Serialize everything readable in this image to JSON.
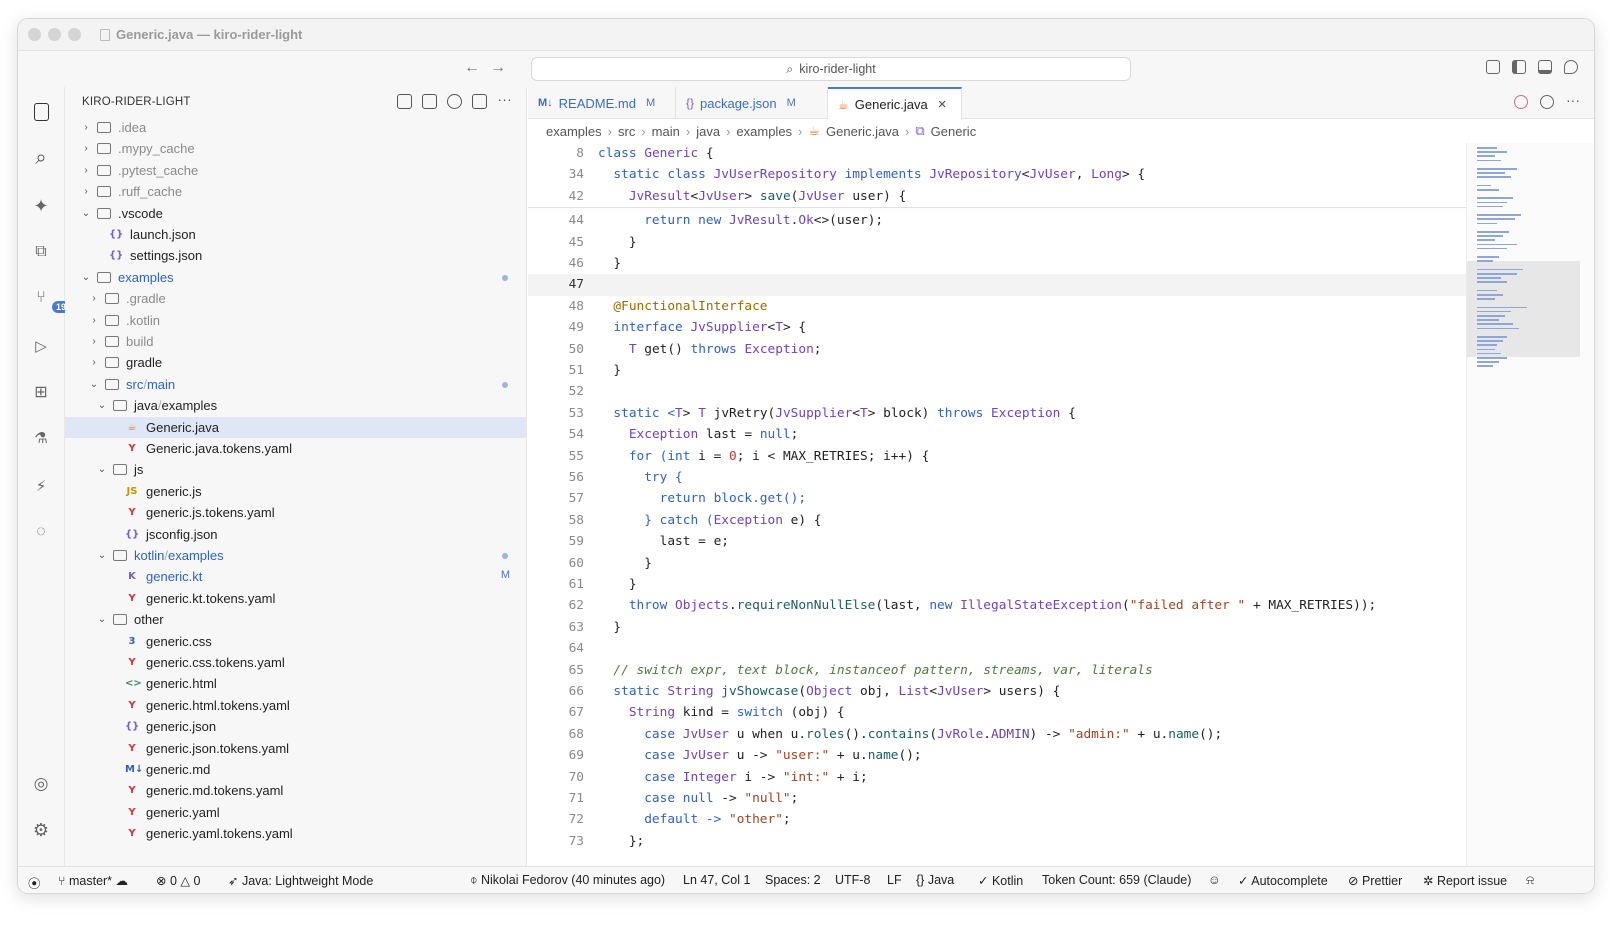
{
  "window": {
    "title": "Generic.java — kiro-rider-light"
  },
  "command_center": {
    "label": "kiro-rider-light"
  },
  "activity": {
    "source_control_badge": "19"
  },
  "explorer": {
    "title": "KIRO-RIDER-LIGHT",
    "items": [
      {
        "label": ".idea"
      },
      {
        "label": ".mypy_cache"
      },
      {
        "label": ".pytest_cache"
      },
      {
        "label": ".ruff_cache"
      },
      {
        "label": ".vscode"
      },
      {
        "label": "launch.json"
      },
      {
        "label": "settings.json"
      },
      {
        "label": "examples"
      },
      {
        "label": ".gradle"
      },
      {
        "label": ".kotlin"
      },
      {
        "label": "build"
      },
      {
        "label": "gradle"
      },
      {
        "label": "src",
        "label2": "main"
      },
      {
        "label": "java",
        "label2": "examples"
      },
      {
        "label": "Generic.java"
      },
      {
        "label": "Generic.java.tokens.yaml"
      },
      {
        "label": "js"
      },
      {
        "label": "generic.js"
      },
      {
        "label": "generic.js.tokens.yaml"
      },
      {
        "label": "jsconfig.json"
      },
      {
        "label": "kotlin",
        "label2": "examples"
      },
      {
        "label": "generic.kt",
        "badge": "M"
      },
      {
        "label": "generic.kt.tokens.yaml"
      },
      {
        "label": "other"
      },
      {
        "label": "generic.css"
      },
      {
        "label": "generic.css.tokens.yaml"
      },
      {
        "label": "generic.html"
      },
      {
        "label": "generic.html.tokens.yaml"
      },
      {
        "label": "generic.json"
      },
      {
        "label": "generic.json.tokens.yaml"
      },
      {
        "label": "generic.md"
      },
      {
        "label": "generic.md.tokens.yaml"
      },
      {
        "label": "generic.yaml"
      },
      {
        "label": "generic.yaml.tokens.yaml"
      }
    ]
  },
  "tabs": [
    {
      "label": "README.md",
      "badge": "M",
      "icon": "M↓"
    },
    {
      "label": "package.json",
      "badge": "M",
      "icon": "{}"
    },
    {
      "label": "Generic.java",
      "icon": "☕",
      "close": "×"
    }
  ],
  "breadcrumb": [
    "examples",
    "src",
    "main",
    "java",
    "examples",
    "Generic.java",
    "Generic"
  ],
  "statusbar": {
    "branch": "master*",
    "errors": "0",
    "warnings": "0",
    "java_mode": "Java: Lightweight Mode",
    "blame": "Nikolai Fedorov (40 minutes ago)",
    "position": "Ln 47, Col 1",
    "spaces": "Spaces: 2",
    "encoding": "UTF-8",
    "eol": "LF",
    "language": "Java",
    "kotlin": "Kotlin",
    "tokens": "Token Count: 659 (Claude)",
    "autocomplete": "Autocomplete",
    "prettier": "Prettier",
    "report": "Report issue"
  },
  "code_lines": [
    {
      "n": "8"
    },
    {
      "n": "34"
    },
    {
      "n": "42"
    },
    {
      "n": "44"
    },
    {
      "n": "45"
    },
    {
      "n": "46"
    },
    {
      "n": "47"
    },
    {
      "n": "48"
    },
    {
      "n": "49"
    },
    {
      "n": "50"
    },
    {
      "n": "51"
    },
    {
      "n": "52"
    },
    {
      "n": "53"
    },
    {
      "n": "54"
    },
    {
      "n": "55"
    },
    {
      "n": "56"
    },
    {
      "n": "57"
    },
    {
      "n": "58"
    },
    {
      "n": "59"
    },
    {
      "n": "60"
    },
    {
      "n": "61"
    },
    {
      "n": "62"
    },
    {
      "n": "63"
    },
    {
      "n": "64"
    },
    {
      "n": "65"
    },
    {
      "n": "66"
    },
    {
      "n": "67"
    },
    {
      "n": "68"
    },
    {
      "n": "69"
    },
    {
      "n": "70"
    },
    {
      "n": "71"
    },
    {
      "n": "72"
    },
    {
      "n": "73"
    }
  ],
  "code_text": [
    [
      "class ",
      "Generic",
      " {"
    ],
    [
      "  static class ",
      "JvUserRepository",
      " implements ",
      "JvRepository",
      "<",
      "JvUser",
      ", ",
      "Long",
      "> {"
    ],
    [
      "    ",
      "JvResult",
      "<",
      "JvUser",
      "> ",
      "save",
      "(",
      "JvUser",
      " user) {"
    ],
    [
      "      return new ",
      "JvResult",
      ".",
      "Ok",
      "<>(user);"
    ],
    [
      "    }"
    ],
    [
      "  }"
    ],
    [
      ""
    ],
    [
      "  ",
      "@FunctionalInterface"
    ],
    [
      "  interface ",
      "JvSupplier",
      "<",
      "T",
      "> {"
    ],
    [
      "    ",
      "T",
      " get() ",
      "throws",
      " ",
      "Exception",
      ";"
    ],
    [
      "  }"
    ],
    [
      ""
    ],
    [
      "  static <",
      "T",
      "> ",
      "T",
      " jvRetry(",
      "JvSupplier",
      "<",
      "T",
      "> block) ",
      "throws",
      " ",
      "Exception",
      " {"
    ],
    [
      "    ",
      "Exception",
      " last = ",
      "null",
      ";"
    ],
    [
      "    for (",
      "int",
      " i = ",
      "0",
      "; i < MAX_RETRIES; i++) {"
    ],
    [
      "      try {"
    ],
    [
      "        return block.get();"
    ],
    [
      "      } catch (",
      "Exception",
      " e) {"
    ],
    [
      "        last = e;"
    ],
    [
      "      }"
    ],
    [
      "    }"
    ],
    [
      "    throw ",
      "Objects",
      ".",
      "requireNonNullElse",
      "(last, ",
      "new",
      " ",
      "IllegalStateException",
      "(",
      "\"failed after \"",
      " + MAX_RETRIES));"
    ],
    [
      "  }"
    ],
    [
      ""
    ],
    [
      "  // switch expr, text block, instanceof pattern, streams, var, literals"
    ],
    [
      "  static ",
      "String",
      " ",
      "jvShowcase",
      "(",
      "Object",
      " obj, ",
      "List",
      "<",
      "JvUser",
      "> users) {"
    ],
    [
      "    ",
      "String",
      " kind = ",
      "switch",
      " (obj) {"
    ],
    [
      "      case ",
      "JvUser",
      " u when u.",
      "roles",
      "().",
      "contains",
      "(",
      "JvRole",
      ".",
      "ADMIN",
      ") -> ",
      "\"admin:\"",
      " + u.",
      "name",
      "();"
    ],
    [
      "      case ",
      "JvUser",
      " u -> ",
      "\"user:\"",
      " + u.",
      "name",
      "();"
    ],
    [
      "      case ",
      "Integer",
      " i -> ",
      "\"int:\"",
      " + i;"
    ],
    [
      "      case ",
      "null",
      " -> ",
      "\"null\"",
      ";"
    ],
    [
      "      default -> ",
      "\"other\"",
      ";"
    ],
    [
      "    };"
    ]
  ],
  "code_classes": [
    [
      "k",
      "t",
      ""
    ],
    [
      "k",
      "t",
      "k",
      "t",
      "",
      "t",
      "",
      "t",
      ""
    ],
    [
      "",
      "t",
      "",
      "t",
      "",
      "f",
      "",
      "t",
      ""
    ],
    [
      "k",
      "t",
      "",
      "t",
      ""
    ],
    [
      ""
    ],
    [
      ""
    ],
    [
      ""
    ],
    [
      "",
      "a"
    ],
    [
      "k",
      "t",
      "",
      "t",
      ""
    ],
    [
      "",
      "t",
      "",
      "k",
      "",
      "t",
      ""
    ],
    [
      ""
    ],
    [
      ""
    ],
    [
      "k",
      "t",
      "",
      "t",
      "",
      "t",
      "",
      "t",
      "",
      "k",
      "",
      "t",
      ""
    ],
    [
      "",
      "t",
      "",
      "k",
      ""
    ],
    [
      "k",
      "k",
      "",
      "n",
      ""
    ],
    [
      "k"
    ],
    [
      "k"
    ],
    [
      "k",
      "t",
      ""
    ],
    [
      ""
    ],
    [
      ""
    ],
    [
      ""
    ],
    [
      "k",
      "t",
      "",
      "f",
      "",
      "k",
      "",
      "t",
      "",
      "s",
      ""
    ],
    [
      ""
    ],
    [
      ""
    ],
    [
      "c"
    ],
    [
      "k",
      "t",
      "",
      "f",
      "",
      "t",
      "",
      "t",
      "",
      "t",
      ""
    ],
    [
      "",
      "t",
      "",
      "k",
      ""
    ],
    [
      "k",
      "t",
      "",
      "f",
      "",
      "f",
      "",
      "t",
      "",
      "fld",
      "",
      "s",
      "",
      "f",
      ""
    ],
    [
      "k",
      "t",
      "",
      "s",
      "",
      "f",
      ""
    ],
    [
      "k",
      "t",
      "",
      "s",
      ""
    ],
    [
      "k",
      "k",
      "",
      "s",
      ""
    ],
    [
      "k",
      "s",
      ""
    ],
    [
      ""
    ]
  ]
}
